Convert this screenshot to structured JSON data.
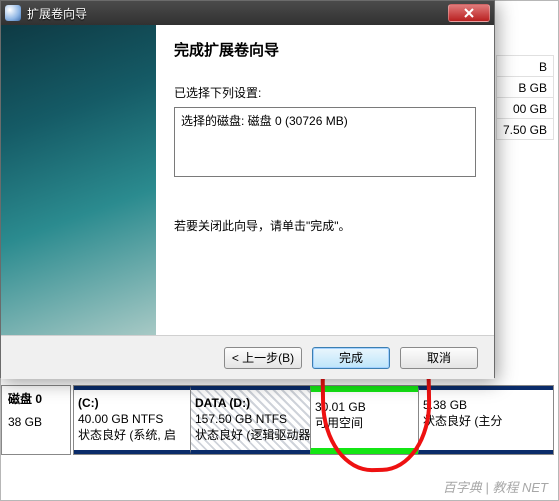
{
  "dialog": {
    "title": "扩展卷向导",
    "heading": "完成扩展卷向导",
    "selected_label": "已选择下列设置:",
    "selected_content": "选择的磁盘: 磁盘 0 (30726 MB)",
    "hint": "若要关闭此向导，请单击\"完成\"。",
    "buttons": {
      "back": "< 上一步(B)",
      "finish": "完成",
      "cancel": "取消"
    }
  },
  "bg_list": {
    "r1": "B",
    "r2": "B GB",
    "r3": "00 GB",
    "r4": "7.50 GB"
  },
  "disk": {
    "label_title": "磁盘 0",
    "label_size": "38 GB",
    "c": {
      "title": "(C:)",
      "size": "40.00 GB NTFS",
      "status": "状态良好 (系统, 启"
    },
    "d": {
      "title": "DATA  (D:)",
      "size": "157.50 GB NTFS",
      "status": "状态良好 (逻辑驱动器"
    },
    "free": {
      "title": "",
      "size": "30.01 GB",
      "status": "可用空间"
    },
    "last": {
      "title": "",
      "size": "5.38 GB",
      "status": "状态良好 (主分"
    }
  },
  "watermark": "百字典 | 教程 NET"
}
